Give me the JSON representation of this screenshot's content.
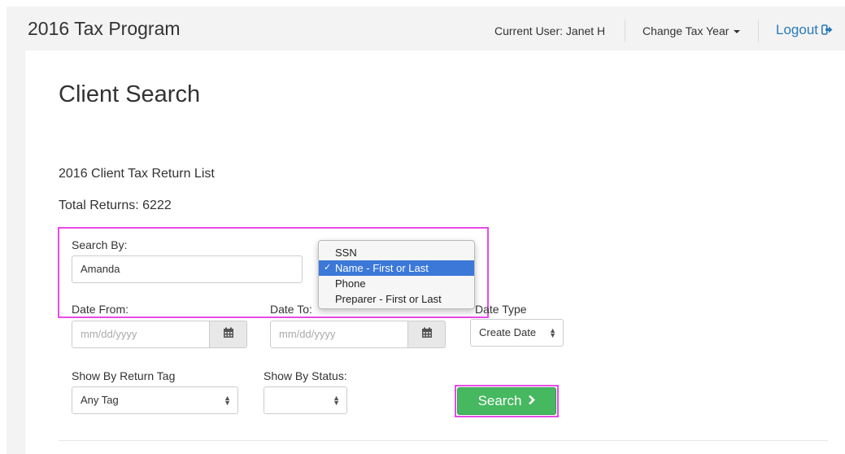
{
  "header": {
    "brand": "2016 Tax Program",
    "current_user": "Current User: Janet H",
    "change_year": "Change Tax Year",
    "logout": "Logout"
  },
  "page": {
    "title": "Client Search",
    "list_title": "2016 Client Tax Return List",
    "total_returns": "Total Returns: 6222"
  },
  "search_form": {
    "search_by": {
      "label": "Search By:",
      "value": "Amanda"
    },
    "search_by_options": [
      {
        "label": "SSN",
        "selected": false
      },
      {
        "label": "Name - First or Last",
        "selected": true
      },
      {
        "label": "Phone",
        "selected": false
      },
      {
        "label": "Preparer - First or Last",
        "selected": false
      }
    ],
    "date_from": {
      "label": "Date From:",
      "placeholder": "mm/dd/yyyy"
    },
    "date_to": {
      "label": "Date To:",
      "placeholder": "mm/dd/yyyy"
    },
    "date_type": {
      "label": "Date Type",
      "value": "Create Date"
    },
    "return_tag": {
      "label": "Show By Return Tag",
      "value": "Any Tag"
    },
    "status": {
      "label": "Show By Status:",
      "value": ""
    },
    "search_button": "Search"
  },
  "colors": {
    "accent_link": "#2a7ab8",
    "search_button": "#46b860",
    "highlight_outline": "#e84ae8",
    "dropdown_selected": "#3b78d8"
  },
  "icons": [
    "calendar-icon",
    "logout-icon",
    "chevron-right-icon",
    "caret-down-icon",
    "select-arrows-icon",
    "checkmark-icon"
  ]
}
